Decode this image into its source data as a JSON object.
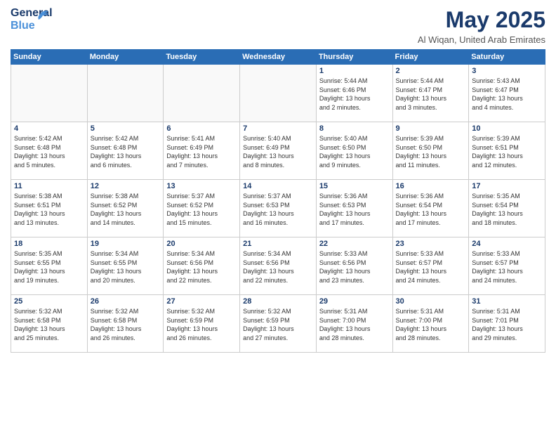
{
  "header": {
    "logo_line1": "General",
    "logo_line2": "Blue",
    "month": "May 2025",
    "location": "Al Wiqan, United Arab Emirates"
  },
  "weekdays": [
    "Sunday",
    "Monday",
    "Tuesday",
    "Wednesday",
    "Thursday",
    "Friday",
    "Saturday"
  ],
  "weeks": [
    [
      {
        "day": "",
        "info": ""
      },
      {
        "day": "",
        "info": ""
      },
      {
        "day": "",
        "info": ""
      },
      {
        "day": "",
        "info": ""
      },
      {
        "day": "1",
        "info": "Sunrise: 5:44 AM\nSunset: 6:46 PM\nDaylight: 13 hours\nand 2 minutes."
      },
      {
        "day": "2",
        "info": "Sunrise: 5:44 AM\nSunset: 6:47 PM\nDaylight: 13 hours\nand 3 minutes."
      },
      {
        "day": "3",
        "info": "Sunrise: 5:43 AM\nSunset: 6:47 PM\nDaylight: 13 hours\nand 4 minutes."
      }
    ],
    [
      {
        "day": "4",
        "info": "Sunrise: 5:42 AM\nSunset: 6:48 PM\nDaylight: 13 hours\nand 5 minutes."
      },
      {
        "day": "5",
        "info": "Sunrise: 5:42 AM\nSunset: 6:48 PM\nDaylight: 13 hours\nand 6 minutes."
      },
      {
        "day": "6",
        "info": "Sunrise: 5:41 AM\nSunset: 6:49 PM\nDaylight: 13 hours\nand 7 minutes."
      },
      {
        "day": "7",
        "info": "Sunrise: 5:40 AM\nSunset: 6:49 PM\nDaylight: 13 hours\nand 8 minutes."
      },
      {
        "day": "8",
        "info": "Sunrise: 5:40 AM\nSunset: 6:50 PM\nDaylight: 13 hours\nand 9 minutes."
      },
      {
        "day": "9",
        "info": "Sunrise: 5:39 AM\nSunset: 6:50 PM\nDaylight: 13 hours\nand 11 minutes."
      },
      {
        "day": "10",
        "info": "Sunrise: 5:39 AM\nSunset: 6:51 PM\nDaylight: 13 hours\nand 12 minutes."
      }
    ],
    [
      {
        "day": "11",
        "info": "Sunrise: 5:38 AM\nSunset: 6:51 PM\nDaylight: 13 hours\nand 13 minutes."
      },
      {
        "day": "12",
        "info": "Sunrise: 5:38 AM\nSunset: 6:52 PM\nDaylight: 13 hours\nand 14 minutes."
      },
      {
        "day": "13",
        "info": "Sunrise: 5:37 AM\nSunset: 6:52 PM\nDaylight: 13 hours\nand 15 minutes."
      },
      {
        "day": "14",
        "info": "Sunrise: 5:37 AM\nSunset: 6:53 PM\nDaylight: 13 hours\nand 16 minutes."
      },
      {
        "day": "15",
        "info": "Sunrise: 5:36 AM\nSunset: 6:53 PM\nDaylight: 13 hours\nand 17 minutes."
      },
      {
        "day": "16",
        "info": "Sunrise: 5:36 AM\nSunset: 6:54 PM\nDaylight: 13 hours\nand 17 minutes."
      },
      {
        "day": "17",
        "info": "Sunrise: 5:35 AM\nSunset: 6:54 PM\nDaylight: 13 hours\nand 18 minutes."
      }
    ],
    [
      {
        "day": "18",
        "info": "Sunrise: 5:35 AM\nSunset: 6:55 PM\nDaylight: 13 hours\nand 19 minutes."
      },
      {
        "day": "19",
        "info": "Sunrise: 5:34 AM\nSunset: 6:55 PM\nDaylight: 13 hours\nand 20 minutes."
      },
      {
        "day": "20",
        "info": "Sunrise: 5:34 AM\nSunset: 6:56 PM\nDaylight: 13 hours\nand 22 minutes."
      },
      {
        "day": "21",
        "info": "Sunrise: 5:34 AM\nSunset: 6:56 PM\nDaylight: 13 hours\nand 22 minutes."
      },
      {
        "day": "22",
        "info": "Sunrise: 5:33 AM\nSunset: 6:56 PM\nDaylight: 13 hours\nand 23 minutes."
      },
      {
        "day": "23",
        "info": "Sunrise: 5:33 AM\nSunset: 6:57 PM\nDaylight: 13 hours\nand 24 minutes."
      },
      {
        "day": "24",
        "info": "Sunrise: 5:33 AM\nSunset: 6:57 PM\nDaylight: 13 hours\nand 24 minutes."
      }
    ],
    [
      {
        "day": "25",
        "info": "Sunrise: 5:32 AM\nSunset: 6:58 PM\nDaylight: 13 hours\nand 25 minutes."
      },
      {
        "day": "26",
        "info": "Sunrise: 5:32 AM\nSunset: 6:58 PM\nDaylight: 13 hours\nand 26 minutes."
      },
      {
        "day": "27",
        "info": "Sunrise: 5:32 AM\nSunset: 6:59 PM\nDaylight: 13 hours\nand 26 minutes."
      },
      {
        "day": "28",
        "info": "Sunrise: 5:32 AM\nSunset: 6:59 PM\nDaylight: 13 hours\nand 27 minutes."
      },
      {
        "day": "29",
        "info": "Sunrise: 5:31 AM\nSunset: 7:00 PM\nDaylight: 13 hours\nand 28 minutes."
      },
      {
        "day": "30",
        "info": "Sunrise: 5:31 AM\nSunset: 7:00 PM\nDaylight: 13 hours\nand 28 minutes."
      },
      {
        "day": "31",
        "info": "Sunrise: 5:31 AM\nSunset: 7:01 PM\nDaylight: 13 hours\nand 29 minutes."
      }
    ]
  ]
}
